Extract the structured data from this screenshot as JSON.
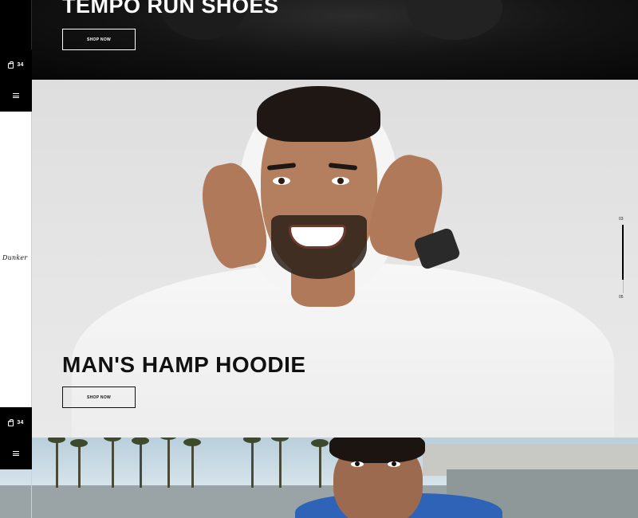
{
  "slides": [
    {
      "id": "tempo",
      "title": "TEMPO RUN SHOES",
      "button_label": "SHOP NOW",
      "cart_count": "34"
    },
    {
      "id": "hoodie",
      "title": "MAN'S HAMP HOODIE",
      "button_label": "SHOP NOW",
      "cart_count": "34",
      "logo_text": "Dunker",
      "pager": {
        "current": "03",
        "total": "05",
        "progress": 0.8
      }
    },
    {
      "id": "court"
    }
  ],
  "icons": {
    "menu": "hamburger-icon",
    "cart": "shopping-bag-icon"
  },
  "colors": {
    "dark_bg": "#000000",
    "accent_text_dark": "#ffffff",
    "accent_text_light": "#111111"
  }
}
